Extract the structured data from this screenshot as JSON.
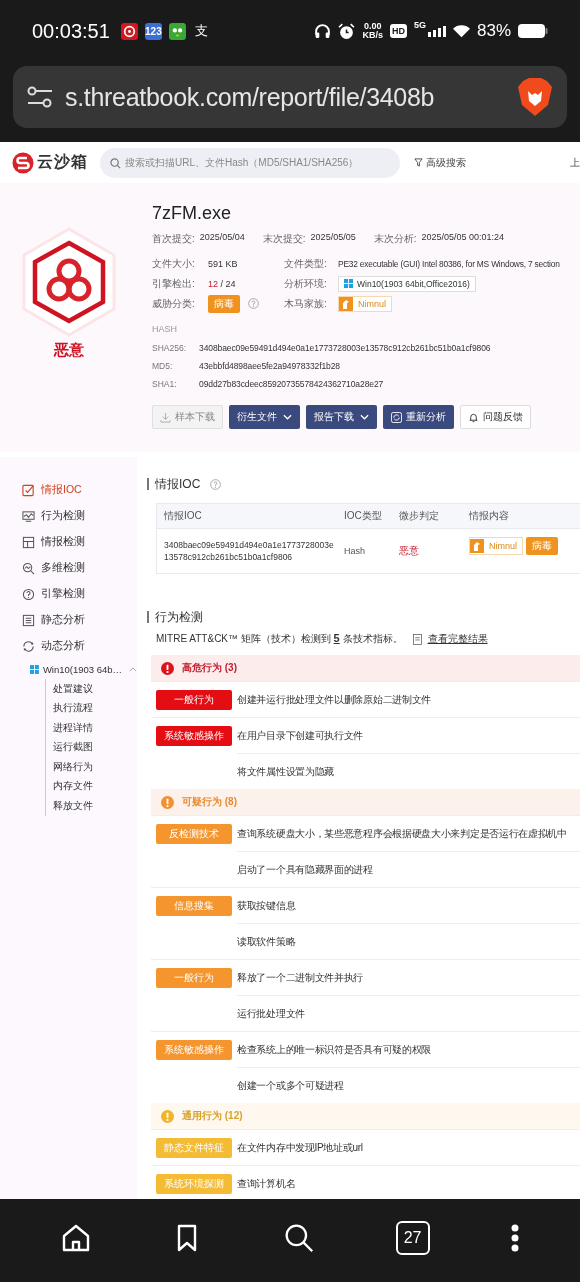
{
  "status_bar": {
    "time": "00:03:51",
    "notification_labels": [
      "123",
      "支"
    ],
    "net_speed": "0.00",
    "net_unit": "KB/s",
    "hd": "HD",
    "network": "5G",
    "battery": "83%"
  },
  "browser": {
    "url": "s.threatbook.com/report/file/3408b",
    "tab_count": "27"
  },
  "site_header": {
    "logo": "云沙箱",
    "search_placeholder": "搜索或扫描URL、文件Hash（MD5/SHA1/SHA256）",
    "advanced_search": "高级搜索",
    "cut_link": "上"
  },
  "summary": {
    "verdict": "恶意",
    "file_name": "7zFM.exe",
    "dates": [
      {
        "label": "首次提交:",
        "value": "2025/05/04"
      },
      {
        "label": "末次提交:",
        "value": "2025/05/05"
      },
      {
        "label": "末次分析:",
        "value": "2025/05/05 00:01:24"
      }
    ],
    "file_size": {
      "label": "文件大小:",
      "value": "591 KB"
    },
    "engines": {
      "label": "引擎检出:",
      "detected": "12",
      "total": "/ 24"
    },
    "threat_class": {
      "label": "威胁分类:",
      "tag": "病毒"
    },
    "file_type": {
      "label": "文件类型:",
      "value": "PE32 executable (GUI) Intel 80386, for MS Windows, 7 section"
    },
    "environment": {
      "label": "分析环境:",
      "value": "Win10(1903 64bit,Office2016)"
    },
    "family": {
      "label": "木马家族:",
      "value": "Nimnul"
    },
    "hash_heading": "HASH",
    "hashes": [
      {
        "label": "SHA256:",
        "value": "3408baec09e59491d494e0a1e1773728003e13578c912cb261bc51b0a1cf9806"
      },
      {
        "label": "MD5:",
        "value": "43ebbfd4898aee5fe2a94978332f1b28"
      },
      {
        "label": "SHA1:",
        "value": "09dd27b83cdeec85920735578424362710a28e27"
      }
    ],
    "buttons": [
      {
        "label": "样本下载",
        "kind": "disabled"
      },
      {
        "label": "衍生文件",
        "kind": "dropdown"
      },
      {
        "label": "报告下载",
        "kind": "dropdown"
      },
      {
        "label": "重新分析",
        "kind": "primary"
      },
      {
        "label": "问题反馈",
        "kind": "outline"
      }
    ]
  },
  "sidebar": {
    "items": [
      {
        "label": "情报IOC",
        "selected": true
      },
      {
        "label": "行为检测",
        "selected": false
      },
      {
        "label": "情报检测",
        "selected": false
      },
      {
        "label": "多维检测",
        "selected": false
      },
      {
        "label": "引擎检测",
        "selected": false
      },
      {
        "label": "静态分析",
        "selected": false
      },
      {
        "label": "动态分析",
        "selected": false,
        "children": [
          {
            "label": "Win10(1903 64b…",
            "expanded": true,
            "children": [
              {
                "label": "处置建议"
              },
              {
                "label": "执行流程"
              },
              {
                "label": "进程详情"
              },
              {
                "label": "运行截图"
              },
              {
                "label": "网络行为"
              },
              {
                "label": "内存文件"
              },
              {
                "label": "释放文件"
              }
            ]
          }
        ]
      }
    ]
  },
  "ioc": {
    "title": "情报IOC",
    "columns": [
      "情报IOC",
      "IOC类型",
      "微步判定",
      "情报内容"
    ],
    "rows": [
      {
        "ioc": "3408baec09e59491d494e0a1e1773728003e13578c912cb261bc51b0a1cf9806",
        "type": "Hash",
        "verdict": "恶意",
        "family": "Nimnul",
        "tag": "病毒"
      }
    ]
  },
  "behavior": {
    "title": "行为检测",
    "mitre": "MITRE ATT&CK™ 矩阵（技术）检测到 **5** 条技术指标。",
    "full_results": "查看完整结果",
    "groups": [
      {
        "title": "高危行为 (3)",
        "kind": "high",
        "rows": [
          {
            "tag": "一般行为",
            "text": "创建并运行批处理文件以删除原始二进制文件"
          },
          {
            "tag": "系统敏感操作",
            "text": "在用户目录下创建可执行文件"
          },
          {
            "text": "将文件属性设置为隐藏"
          }
        ]
      },
      {
        "title": "可疑行为 (8)",
        "kind": "suspicious",
        "rows": [
          {
            "tag": "反检测技术",
            "text": "查询系统硬盘大小，某些恶意程序会根据硬盘大小来判定是否运行在虚拟机中"
          },
          {
            "text": "启动了一个具有隐藏界面的进程"
          },
          {
            "tag": "信息搜集",
            "text": "获取按键信息"
          },
          {
            "text": "读取软件策略"
          },
          {
            "tag": "一般行为",
            "text": "释放了一个二进制文件并执行"
          },
          {
            "text": "运行批处理文件"
          },
          {
            "tag": "系统敏感操作",
            "text": "检查系统上的唯一标识符是否具有可疑的权限"
          },
          {
            "text": "创建一个或多个可疑进程"
          }
        ]
      },
      {
        "title": "通用行为 (12)",
        "kind": "general",
        "rows": [
          {
            "tag": "静态文件特征",
            "text": "在文件内存中发现IP地址或url"
          },
          {
            "tag": "系统环境探测",
            "text": "查询计算机名"
          }
        ]
      }
    ]
  }
}
